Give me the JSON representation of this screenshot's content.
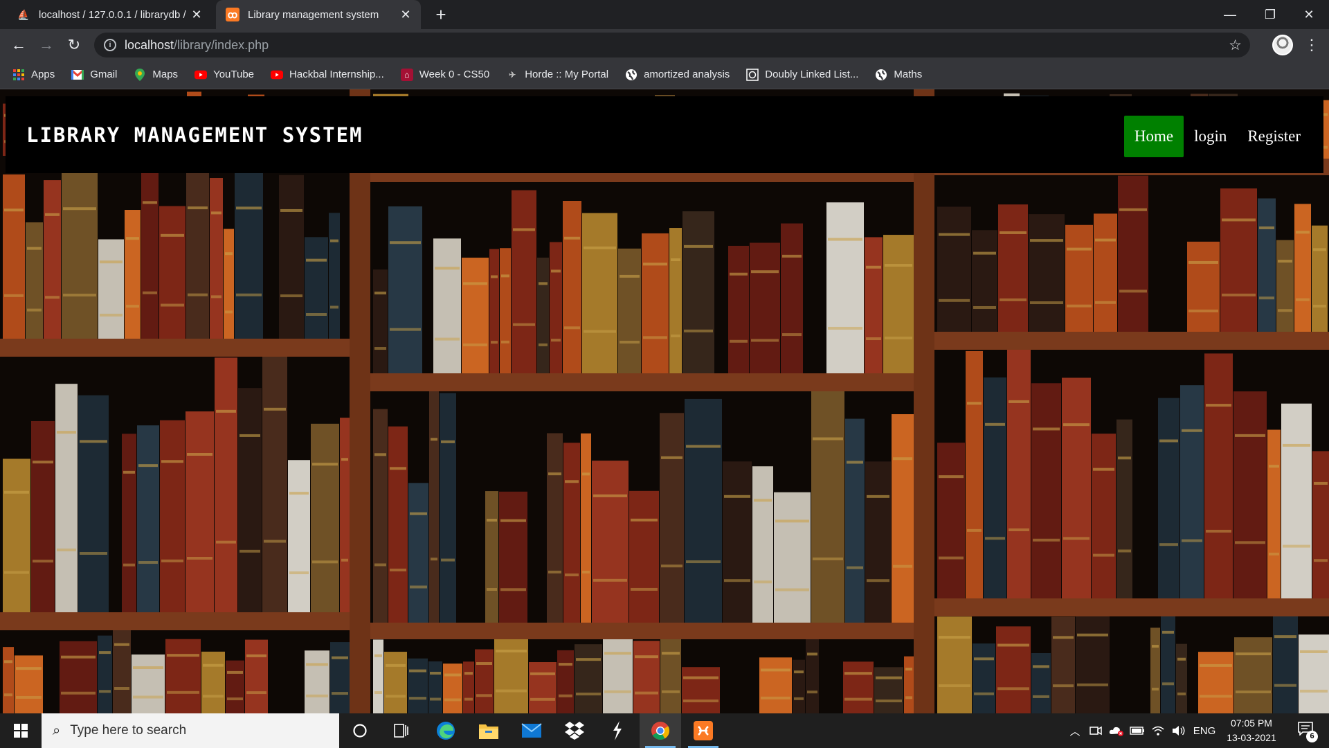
{
  "browser": {
    "tabs": [
      {
        "title": "localhost / 127.0.0.1 / librarydb /",
        "favicon": "phpmyadmin-icon",
        "active": false
      },
      {
        "title": "Library management system",
        "favicon": "xampp-icon",
        "active": true
      }
    ],
    "new_tab_glyph": "+",
    "close_glyph": "✕",
    "url_host": "localhost",
    "url_path": "/library/index.php"
  },
  "bookmarks": [
    {
      "label": "Apps",
      "icon": "apps-grid-icon"
    },
    {
      "label": "Gmail",
      "icon": "gmail-icon"
    },
    {
      "label": "Maps",
      "icon": "maps-icon"
    },
    {
      "label": "YouTube",
      "icon": "youtube-icon"
    },
    {
      "label": "Hackbal Internship...",
      "icon": "youtube-icon"
    },
    {
      "label": "Week 0 - CS50",
      "icon": "cs50-icon"
    },
    {
      "label": "Horde :: My Portal",
      "icon": "horde-icon"
    },
    {
      "label": "amortized analysis",
      "icon": "globe-icon"
    },
    {
      "label": "Doubly Linked List...",
      "icon": "geeks-icon"
    },
    {
      "label": "Maths",
      "icon": "globe-icon"
    }
  ],
  "site": {
    "title": "LIBRARY MANAGEMENT SYSTEM",
    "nav": [
      {
        "label": "Home",
        "active": true
      },
      {
        "label": "login",
        "active": false
      },
      {
        "label": "Register",
        "active": false
      }
    ],
    "colors": {
      "header_bg": "#000000",
      "active_nav": "#008000",
      "text": "#ffffff"
    }
  },
  "taskbar": {
    "search_placeholder": "Type here to search",
    "language": "ENG",
    "time": "07:05 PM",
    "date": "13-03-2021",
    "notification_count": "6"
  }
}
